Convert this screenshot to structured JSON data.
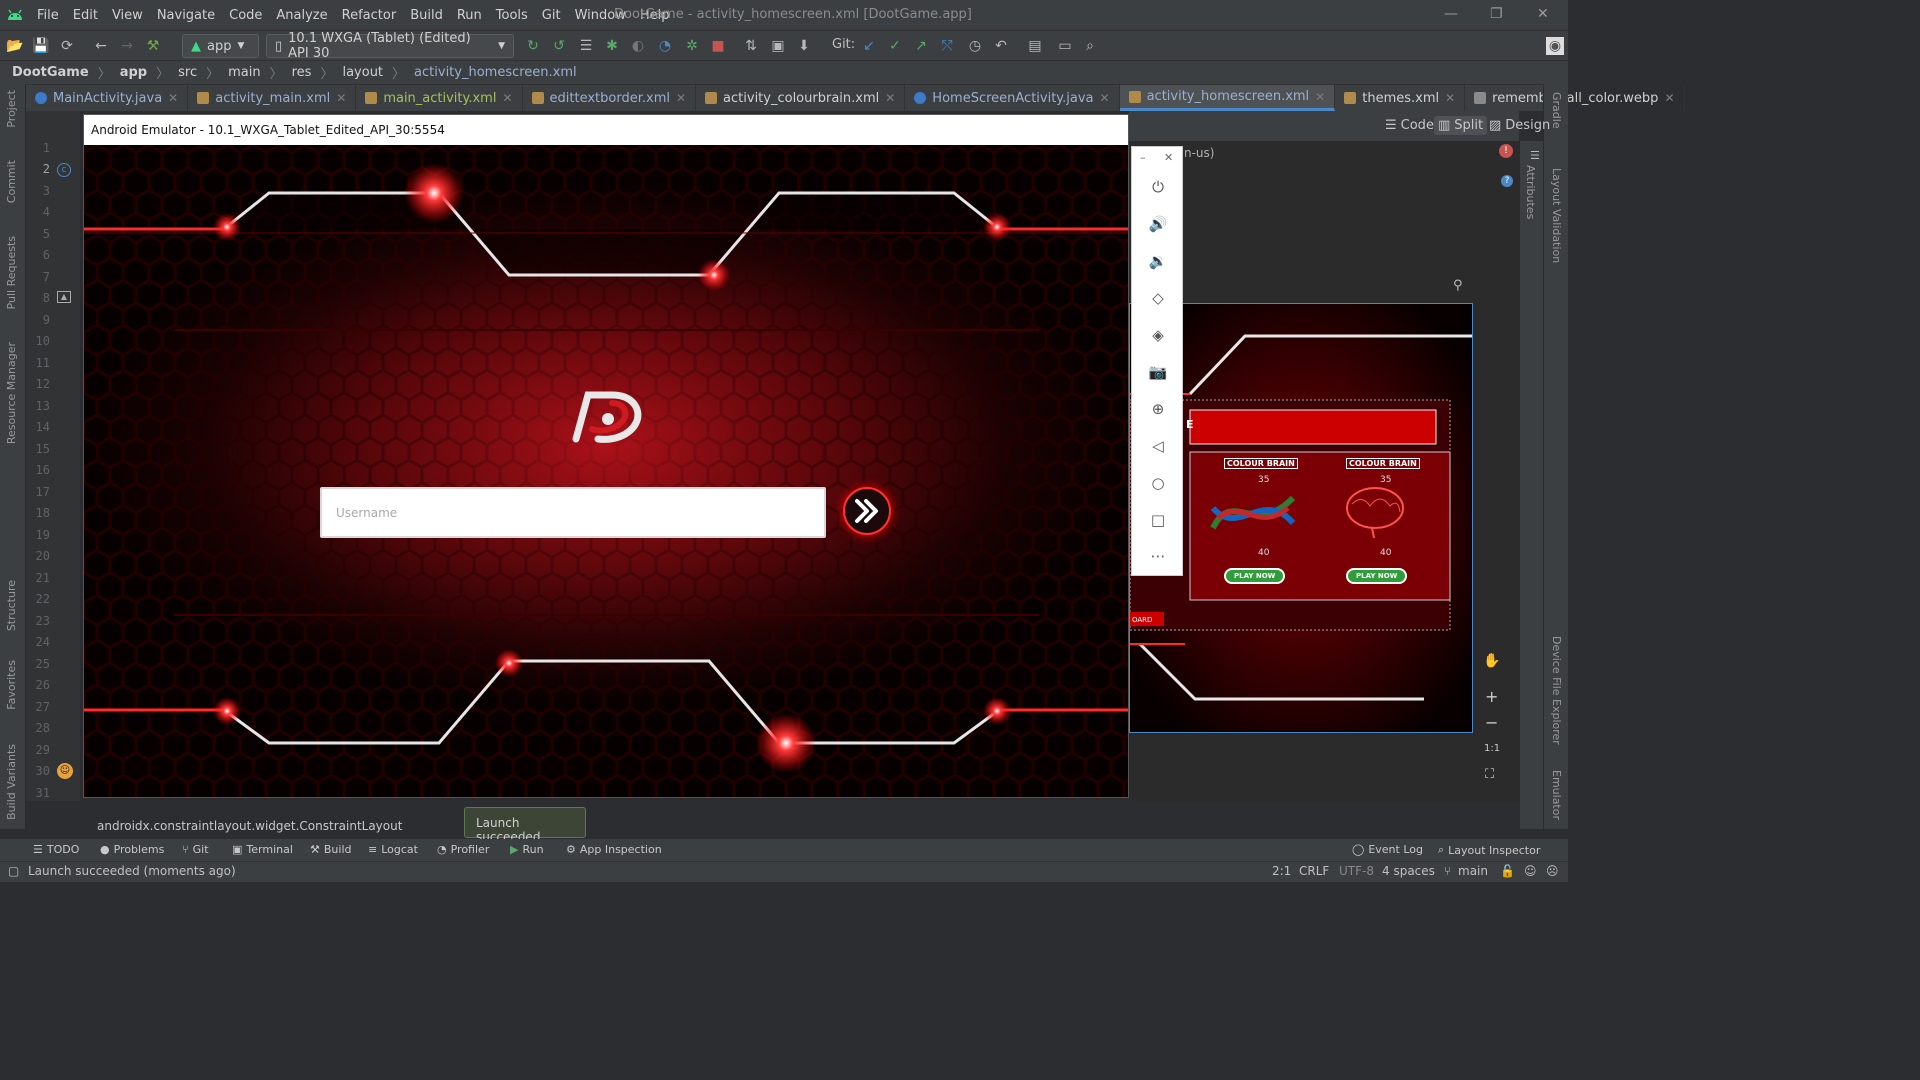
{
  "menu": {
    "items": [
      "File",
      "Edit",
      "View",
      "Navigate",
      "Code",
      "Analyze",
      "Refactor",
      "Build",
      "Run",
      "Tools",
      "Git",
      "Window",
      "Help"
    ],
    "window_title": "DootGame - activity_homescreen.xml [DootGame.app]"
  },
  "toolbar": {
    "module": "app",
    "device": "10.1  WXGA (Tablet) (Edited) API 30",
    "git_label": "Git:"
  },
  "breadcrumb": [
    "DootGame",
    "app",
    "src",
    "main",
    "res",
    "layout",
    "activity_homescreen.xml"
  ],
  "tabs": [
    "MainActivity.java",
    "activity_main.xml",
    "main_activity.xml",
    "edittextborder.xml",
    "activity_colourbrain.xml",
    "HomeScreenActivity.java",
    "activity_homescreen.xml",
    "themes.xml",
    "remember_all_color.webp"
  ],
  "left_tools": [
    "Project",
    "Commit",
    "Pull Requests",
    "Resource Manager",
    "Structure",
    "Favorites",
    "Build Variants"
  ],
  "right_tools": [
    "Gradle",
    "Layout Validation",
    "Attributes",
    "Device File Explorer",
    "Emulator"
  ],
  "line_numbers": [
    "1",
    "2",
    "3",
    "4",
    "5",
    "6",
    "7",
    "8",
    "9",
    "10",
    "11",
    "12",
    "13",
    "14",
    "15",
    "16",
    "17",
    "18",
    "19",
    "20",
    "21",
    "22",
    "23",
    "24",
    "25",
    "26",
    "27",
    "28",
    "29",
    "30",
    "31"
  ],
  "design": {
    "code": "Code",
    "split": "Split",
    "design": "Design",
    "locale": "n-us)",
    "zoom_fit": "1:1",
    "preview_cards": [
      {
        "title": "COLOUR BRAIN",
        "top": "35",
        "bottom": "40",
        "play": "PLAY NOW"
      },
      {
        "title": "COLOUR BRAIN",
        "top": "35",
        "bottom": "40",
        "play": "PLAY NOW"
      }
    ],
    "preview_header": "E",
    "preview_btn": "OARD"
  },
  "emulator": {
    "title": "Android Emulator - 10.1_WXGA_Tablet_Edited_API_30:5554",
    "username_placeholder": "Username"
  },
  "status": {
    "component": "androidx.constraintlayout.widget.ConstraintLayout",
    "toast": "Launch succeeded",
    "message": "Launch succeeded (moments ago)",
    "position": "2:1",
    "line_sep": "CRLF",
    "encoding": "UTF-8",
    "indent": "4 spaces",
    "branch": "main"
  },
  "bottom_tools": [
    "TODO",
    "Problems",
    "Git",
    "Terminal",
    "Build",
    "Logcat",
    "Profiler",
    "Run",
    "App Inspection"
  ],
  "bottom_right_tools": [
    "Event Log",
    "Layout Inspector"
  ],
  "colors": {
    "accent": "#4a88c7",
    "ide_bg": "#2b2d30",
    "emulator_red": "#ff2a2a"
  }
}
